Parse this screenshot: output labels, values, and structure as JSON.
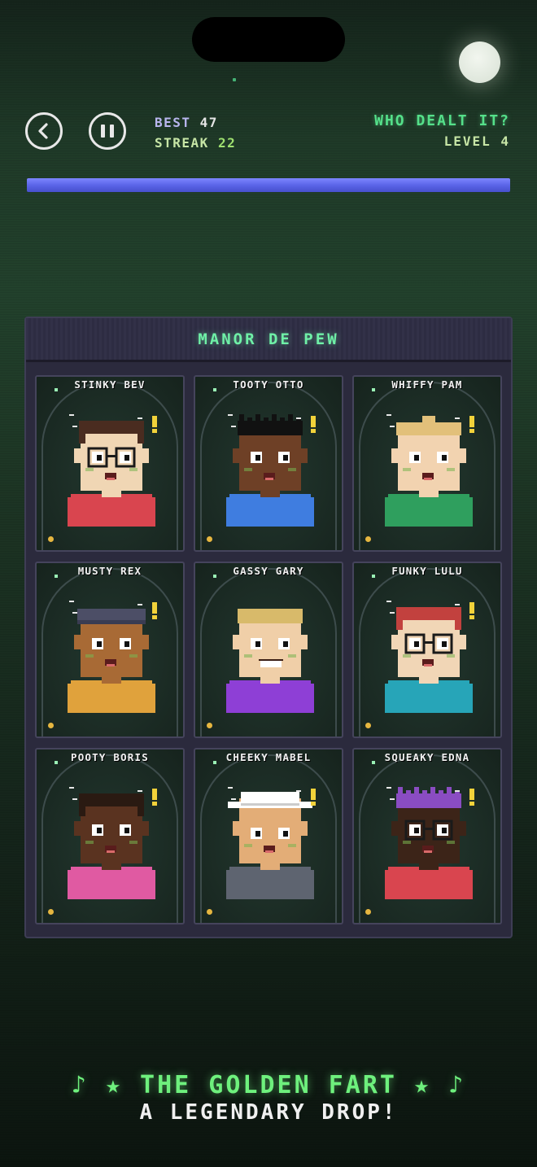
{
  "header": {
    "best_label": "BEST",
    "best_value": "47",
    "streak_label": "STREAK",
    "streak_value": "22",
    "title": "WHO DEALT IT?",
    "level": "LEVEL 4",
    "progress": 1.0
  },
  "colors": {
    "accent_green": "#55e08a",
    "progress_blue": "#5862e6",
    "board_bg": "#2b2a3d"
  },
  "board": {
    "title": "MANOR DE PEW",
    "characters": [
      {
        "name": "STINKY BEV",
        "skin": "#f0d6b4",
        "hair": "#4a2c20",
        "shirt": "#d9454f",
        "glasses": true,
        "hat": "none",
        "alert": true,
        "blush": true
      },
      {
        "name": "TOOTY OTTO",
        "skin": "#6e4026",
        "hair": "#111111",
        "shirt": "#3f7de0",
        "glasses": false,
        "hat": "spiky",
        "alert": true,
        "blush": true
      },
      {
        "name": "WHIFFY PAM",
        "skin": "#f2d3b0",
        "hair": "#e2c07a",
        "shirt": "#2f9f5e",
        "glasses": false,
        "hat": "bun",
        "alert": true,
        "blush": true
      },
      {
        "name": "MUSTY REX",
        "skin": "#a86a35",
        "hair": "#4c4e66",
        "shirt": "#e0a23c",
        "glasses": false,
        "hat": "cap",
        "alert": true,
        "blush": true
      },
      {
        "name": "GASSY GARY",
        "skin": "#f0cfa8",
        "hair": "#d8ba6a",
        "shirt": "#8e3fd6",
        "glasses": false,
        "hat": "flat",
        "alert": false,
        "blush": true
      },
      {
        "name": "FUNKY LULU",
        "skin": "#f1d6b6",
        "hair": "#c2413e",
        "shirt": "#27a5b8",
        "glasses": true,
        "hat": "none",
        "alert": true,
        "blush": true
      },
      {
        "name": "POOTY BORIS",
        "skin": "#5a3320",
        "hair": "#2a1a12",
        "shirt": "#e05aa2",
        "glasses": false,
        "hat": "none",
        "alert": true,
        "blush": true
      },
      {
        "name": "CHEEKY MABEL",
        "skin": "#e3ad77",
        "hair": "#ffffff",
        "shirt": "#5e6470",
        "glasses": false,
        "hat": "sunhat",
        "alert": true,
        "blush": true
      },
      {
        "name": "SQUEAKY EDNA",
        "skin": "#3c2418",
        "hair": "#8a4cc2",
        "shirt": "#d9454f",
        "glasses": true,
        "hat": "spiky",
        "alert": true,
        "blush": true
      }
    ]
  },
  "footer": {
    "line1": "♪ ★ THE GOLDEN FART ★ ♪",
    "line2": "A LEGENDARY DROP!"
  }
}
